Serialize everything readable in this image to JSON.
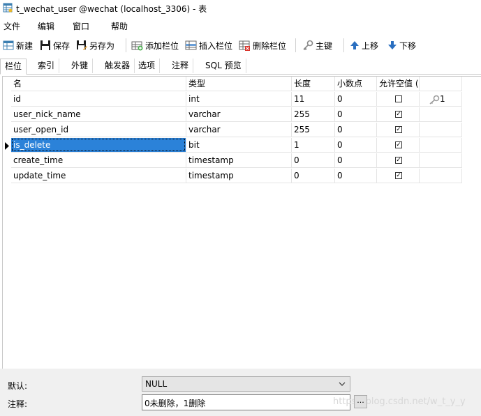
{
  "window": {
    "title": "t_wechat_user @wechat (localhost_3306) - 表"
  },
  "menu": [
    "文件",
    "编辑",
    "窗口",
    "帮助"
  ],
  "toolbar": {
    "new_label": "新建",
    "save_label": "保存",
    "save_as_label": "另存为",
    "add_field_label": "添加栏位",
    "insert_field_label": "插入栏位",
    "delete_field_label": "删除栏位",
    "primary_key_label": "主键",
    "move_up_label": "上移",
    "move_down_label": "下移"
  },
  "tabs": [
    "栏位",
    "索引",
    "外键",
    "触发器",
    "选项",
    "注释",
    "SQL 预览"
  ],
  "grid": {
    "headers": [
      "名",
      "类型",
      "长度",
      "小数点",
      "允许空值 (",
      ""
    ],
    "rows": [
      {
        "name": "id",
        "type": "int",
        "length": "11",
        "decimals": "0",
        "nullable": false,
        "key": "1"
      },
      {
        "name": "user_nick_name",
        "type": "varchar",
        "length": "255",
        "decimals": "0",
        "nullable": true,
        "key": ""
      },
      {
        "name": "user_open_id",
        "type": "varchar",
        "length": "255",
        "decimals": "0",
        "nullable": true,
        "key": ""
      },
      {
        "name": "is_delete",
        "type": "bit",
        "length": "1",
        "decimals": "0",
        "nullable": true,
        "key": ""
      },
      {
        "name": "create_time",
        "type": "timestamp",
        "length": "0",
        "decimals": "0",
        "nullable": true,
        "key": ""
      },
      {
        "name": "update_time",
        "type": "timestamp",
        "length": "0",
        "decimals": "0",
        "nullable": true,
        "key": ""
      }
    ],
    "selected_row": 3
  },
  "properties": {
    "default_label": "默认:",
    "default_value": "NULL",
    "comment_label": "注释:",
    "comment_value": "0未删除，1删除",
    "ellipsis": "..."
  },
  "watermark": "https://blog.csdn.net/w_t_y_y"
}
